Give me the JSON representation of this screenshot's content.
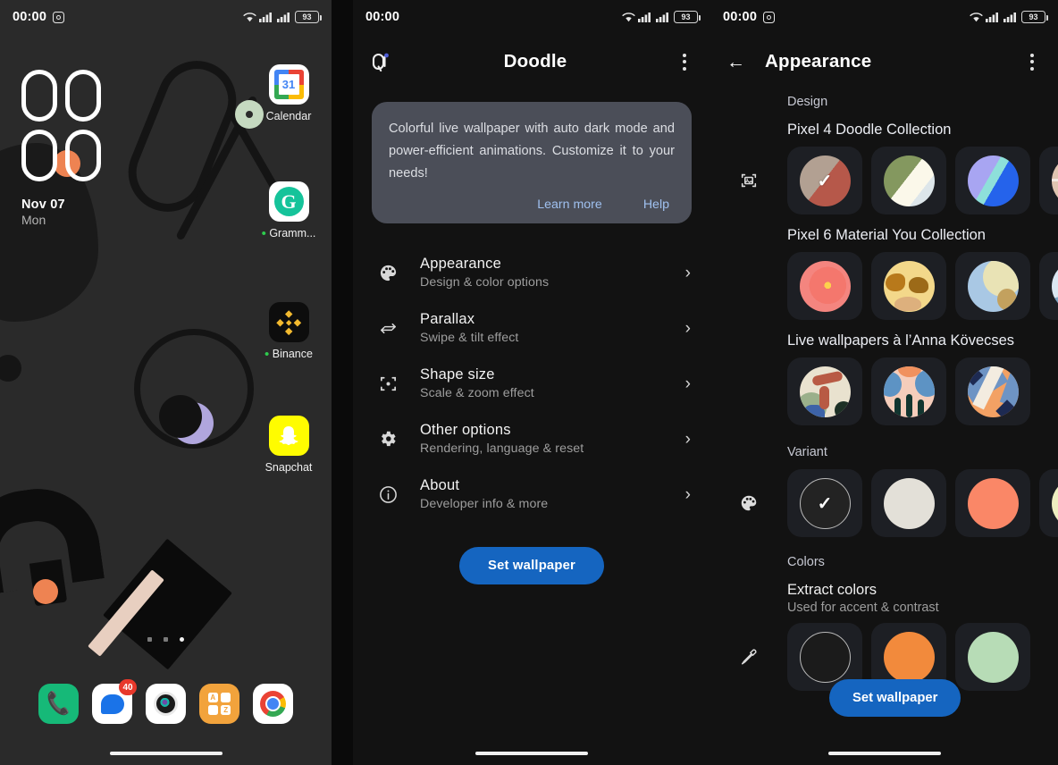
{
  "home": {
    "status": {
      "time": "00:00",
      "battery": "93",
      "camera_icon": "camera-icon",
      "wifi_icon": "wifi-icon",
      "signal_icon": "signal-bars-icon"
    },
    "clock": {
      "hours": "00",
      "minutes": "00",
      "date": "Nov 07",
      "weekday": "Mon"
    },
    "apps": [
      {
        "label": "Calendar",
        "icon": "google-calendar-icon",
        "day": "31",
        "dot": false
      },
      {
        "label": "Gramm...",
        "icon": "grammarly-icon",
        "dot": true
      },
      {
        "label": "Binance",
        "icon": "binance-icon",
        "dot": true
      },
      {
        "label": "Snapchat",
        "icon": "snapchat-icon",
        "dot": false
      }
    ],
    "dock": [
      {
        "label": "Phone",
        "icon": "phone-icon",
        "badge": ""
      },
      {
        "label": "Messages",
        "icon": "messages-icon",
        "badge": "40"
      },
      {
        "label": "Camera",
        "icon": "camera-app-icon",
        "badge": ""
      },
      {
        "label": "App drawer",
        "icon": "apps-grid-icon",
        "badge": ""
      },
      {
        "label": "Chrome",
        "icon": "chrome-icon",
        "badge": ""
      }
    ],
    "page_dots": {
      "count": 3,
      "active_index": 2
    }
  },
  "settings": {
    "status": {
      "time": "00:00",
      "battery": "93"
    },
    "appbar": {
      "title": "Doodle",
      "left_icon": "doodle-brush-icon",
      "menu_icon": "overflow-menu-icon"
    },
    "info_card": {
      "text": "Colorful live wallpaper with auto dark mode and power-efficient animations. Customize it to your needs!",
      "learn_more": "Learn more",
      "help": "Help"
    },
    "rows": [
      {
        "icon": "palette-icon",
        "title": "Appearance",
        "subtitle": "Design & color options"
      },
      {
        "icon": "parallax-arrows-icon",
        "title": "Parallax",
        "subtitle": "Swipe & tilt effect"
      },
      {
        "icon": "focus-frame-icon",
        "title": "Shape size",
        "subtitle": "Scale & zoom effect"
      },
      {
        "icon": "gear-icon",
        "title": "Other options",
        "subtitle": "Rendering, language & reset"
      },
      {
        "icon": "info-icon",
        "title": "About",
        "subtitle": "Developer info & more"
      }
    ],
    "primary_button": "Set wallpaper"
  },
  "appearance": {
    "status": {
      "time": "00:00",
      "battery": "93",
      "camera_icon": "camera-icon"
    },
    "appbar": {
      "back_icon": "back-arrow-icon",
      "title": "Appearance",
      "menu_icon": "overflow-menu-icon"
    },
    "section_design": "Design",
    "groups": [
      {
        "title": "Pixel 4 Doodle Collection",
        "lead_icon": "image-frame-icon",
        "swatches": [
          {
            "name": "clay-red",
            "selected": true,
            "c1": "#b2a092",
            "c2": "#b6584a"
          },
          {
            "name": "sage-cream",
            "selected": false,
            "c1": "#fbf8ea",
            "c2": "#84985f"
          },
          {
            "name": "blue-mint",
            "selected": false,
            "c1": "#a8a5f2",
            "c2": "#2563eb"
          },
          {
            "name": "beige-grid",
            "selected": false,
            "c1": "#e0c5b1",
            "c2": "#f3e9e2"
          }
        ]
      },
      {
        "title": "Pixel 6 Material You Collection",
        "lead_icon": "",
        "swatches": [
          {
            "name": "red-floral",
            "selected": false,
            "c1": "#f4857f",
            "c2": "#f05a4d"
          },
          {
            "name": "amber-leaf",
            "selected": false,
            "c1": "#f3d88a",
            "c2": "#b8791b"
          },
          {
            "name": "sky-sand",
            "selected": false,
            "c1": "#a9c8e4",
            "c2": "#e9e3b5"
          },
          {
            "name": "ice-blue",
            "selected": false,
            "c1": "#dbe7f2",
            "c2": "#7fa6c4"
          }
        ]
      },
      {
        "title": "Live wallpapers à l’Anna Kövecses",
        "lead_icon": "",
        "swatches": [
          {
            "name": "kovecses-1",
            "selected": false,
            "c1": "#e9e2cf",
            "c2": "#b85a44"
          },
          {
            "name": "kovecses-2",
            "selected": false,
            "c1": "#f5cdbb",
            "c2": "#5d93c4"
          },
          {
            "name": "kovecses-3",
            "selected": false,
            "c1": "#f3a164",
            "c2": "#6e94c4"
          }
        ]
      }
    ],
    "variant": {
      "label": "Variant",
      "lead_icon": "palette-icon",
      "swatches": [
        {
          "name": "auto-dark",
          "selected": true,
          "color": "#232323"
        },
        {
          "name": "cream",
          "selected": false,
          "color": "#e3e0d8"
        },
        {
          "name": "coral",
          "selected": false,
          "color": "#fa8767"
        },
        {
          "name": "pale-yellow",
          "selected": false,
          "color": "#eeeec0"
        }
      ]
    },
    "colors": {
      "label": "Colors",
      "title": "Extract colors",
      "subtitle": "Used for accent & contrast",
      "lead_icon": "eyedropper-icon",
      "swatches": [
        {
          "name": "none",
          "color": "#1b1b1b",
          "ring": true
        },
        {
          "name": "orange",
          "color": "#f28a3c",
          "ring": false
        },
        {
          "name": "mint",
          "color": "#b7dcb6",
          "ring": false
        }
      ]
    },
    "float_button": "Set wallpaper"
  },
  "theme": {
    "accent": "#1565c0",
    "link": "#9fc0ef",
    "card": "#4b4e58",
    "bg": "#121212",
    "home_bg": "#2a2a2a"
  }
}
